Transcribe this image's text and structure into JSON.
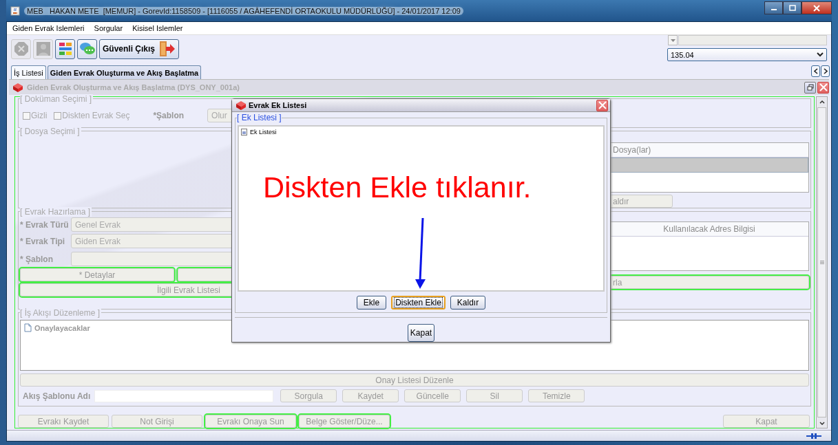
{
  "window": {
    "title": "MEB   HAKAN METE  [MEMUR] - GorevId:1158509 - [1116055 / AGÂHEFENDİ ORTAOKULU MÜDÜRLÜĞÜ] - 24/01/2017 12:09"
  },
  "menu": [
    "Giden Evrak Islemleri",
    "Sorgular",
    "Kisisel Islemler"
  ],
  "toolbar": {
    "icon_buttons": [
      {
        "kind": "stop",
        "disabled": true
      },
      {
        "kind": "person",
        "disabled": true
      },
      {
        "kind": "blocks",
        "disabled": false
      },
      {
        "kind": "chat",
        "disabled": false
      }
    ],
    "exit_button": "Güvenli Çıkış",
    "combo_value": "135.04"
  },
  "tabs": [
    {
      "label": "İş Listesi",
      "selected": false
    },
    {
      "label": "Giden Evrak Oluşturma ve Akış Başlatma",
      "selected": true
    }
  ],
  "frame": {
    "title": "Giden Evrak Oluşturma ve Akış Başlatma (DYS_ONY_001a)"
  },
  "document_selection": {
    "legend": "[ Doküman Seçimi ]",
    "checkboxes": [
      {
        "label": "Gizli",
        "checked": false
      },
      {
        "label": "Diskten Evrak Seç",
        "checked": false
      }
    ],
    "template_label": "*Şablon",
    "template_value": "Olur"
  },
  "file_selection": {
    "legend": "[ Dosya Seçimi ]",
    "column_header": "Dosya(lar)",
    "rows": [
      {
        "selected": true
      }
    ],
    "button": "aldır"
  },
  "document_preparation": {
    "legend": "[ Evrak Hazırlama ]",
    "fields": [
      {
        "label": "* Evrak Türü",
        "value": "Genel Evrak"
      },
      {
        "label": "* Evrak Tipi",
        "value": "Giden Evrak"
      },
      {
        "label": "* Şablon"
      }
    ],
    "detail_buttons": [
      {
        "label": "* Detaylar",
        "highlighted": true
      },
      {
        "highlighted": true
      }
    ],
    "related_button": {
      "label": "İlgili Evrak Listesi",
      "highlighted": true
    },
    "address_header": "Kullanılacak Adres Bilgisi",
    "address_button": {
      "label": "rla",
      "highlighted": true
    }
  },
  "workflow": {
    "legend": "[ İş Akışı Düzenleme ]",
    "tree": [
      {
        "label": "Onaylayacaklar"
      }
    ],
    "edit_button": "Onay Listesi Düzenle",
    "template_name_label": "Akış Şablonu Adı",
    "buttons": [
      "Sorgula",
      "Kaydet",
      "Güncelle",
      "Sil",
      "Temizle"
    ]
  },
  "bottom_buttons": [
    {
      "label": "Evrakı Kaydet",
      "highlighted": false
    },
    {
      "label": "Not Girişi",
      "highlighted": false
    },
    {
      "label": "Evrakı Onaya Sun",
      "highlighted": true
    },
    {
      "label": "Belge Göster/Düze...",
      "highlighted": true
    }
  ],
  "close_button": "Kapat",
  "dialog": {
    "title": "Evrak Ek Listesi",
    "legend": "[ Ek Listesi ]",
    "tree": [
      {
        "label": "Ek Listesi"
      }
    ],
    "buttons": [
      {
        "label": "Ekle",
        "focused": false
      },
      {
        "label": "Diskten Ekle",
        "focused": true
      },
      {
        "label": "Kaldır",
        "focused": false
      }
    ],
    "close_button": "Kapat"
  },
  "annotation": {
    "text": "Diskten Ekle tıklanır."
  }
}
